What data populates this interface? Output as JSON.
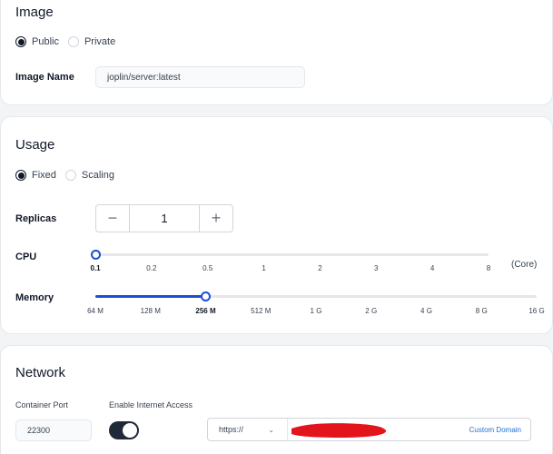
{
  "image_section": {
    "title": "Image",
    "visibility_options": [
      {
        "label": "Public",
        "selected": true
      },
      {
        "label": "Private",
        "selected": false
      }
    ],
    "image_name_label": "Image Name",
    "image_name_value": "joplin/server:latest"
  },
  "usage_section": {
    "title": "Usage",
    "mode_options": [
      {
        "label": "Fixed",
        "selected": true
      },
      {
        "label": "Scaling",
        "selected": false
      }
    ],
    "replicas_label": "Replicas",
    "replicas_value": "1",
    "decrement_symbol": "−",
    "increment_symbol": "+",
    "cpu_label": "CPU",
    "cpu_ticks": [
      "0.1",
      "0.2",
      "0.5",
      "1",
      "2",
      "3",
      "4",
      "8"
    ],
    "cpu_selected": "0.1",
    "cpu_unit": "(Core)",
    "memory_label": "Memory",
    "memory_ticks": [
      "64 M",
      "128 M",
      "256 M",
      "512 M",
      "1 G",
      "2 G",
      "4 G",
      "8 G",
      "16 G"
    ],
    "memory_selected": "256 M"
  },
  "network_section": {
    "title": "Network",
    "container_port_label": "Container Port",
    "container_port_value": "22300",
    "internet_access_label": "Enable Internet Access",
    "internet_access_enabled": true,
    "protocol_value": "https://",
    "custom_domain_label": "Custom Domain"
  },
  "colors": {
    "accent": "#1d4ed8",
    "toggle_on": "#1f2937",
    "link": "#1d72d8",
    "redaction": "#e3141c"
  },
  "icons": {
    "protocol_dropdown": "chevron-down-icon"
  }
}
